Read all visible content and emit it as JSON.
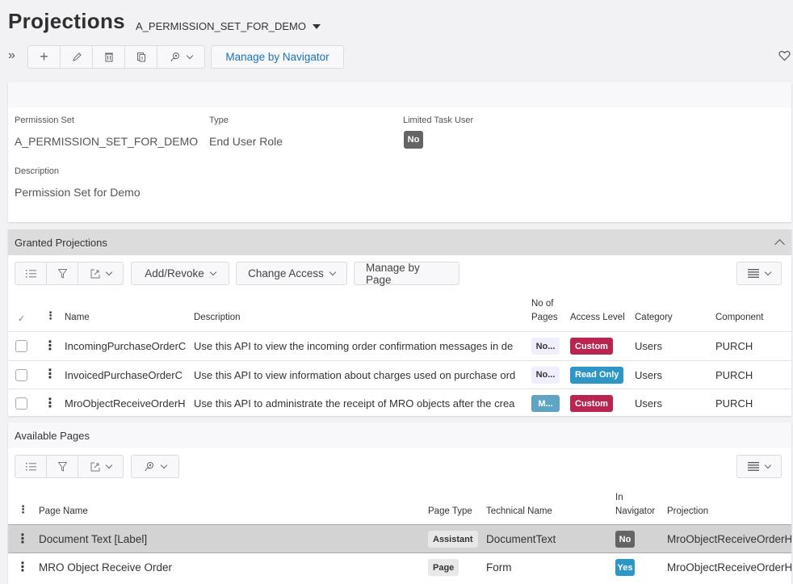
{
  "header": {
    "title": "Projections",
    "record_selector": "A_PERMISSION_SET_FOR_DEMO",
    "toolbar": {
      "icons": [
        "expand-icon",
        "add-icon",
        "edit-icon",
        "delete-icon",
        "duplicate-icon",
        "user-action-icon"
      ],
      "manage_by_navigator": "Manage by Navigator"
    },
    "favorite_icon": "heart-icon"
  },
  "details": {
    "permission_set_label": "Permission Set",
    "permission_set_value": "A_PERMISSION_SET_FOR_DEMO",
    "type_label": "Type",
    "type_value": "End User Role",
    "limited_task_user_label": "Limited Task User",
    "limited_task_user_value": "No",
    "description_label": "Description",
    "description_value": "Permission Set for Demo"
  },
  "granted_projections": {
    "title": "Granted Projections",
    "buttons": {
      "add_revoke": "Add/Revoke",
      "change_access": "Change Access",
      "manage_by_page": "Manage by Page"
    },
    "columns": {
      "name": "Name",
      "description": "Description",
      "no_of_pages_1": "No of",
      "no_of_pages_2": "Pages",
      "access_level": "Access Level",
      "category": "Category",
      "component": "Component"
    },
    "rows": [
      {
        "name": "IncomingPurchaseOrderC",
        "description": "Use this API to view the incoming order confirmation messages in de",
        "no_of_pages": "No...",
        "access_level": "Custom",
        "category": "Users",
        "component": "PURCH"
      },
      {
        "name": "InvoicedPurchaseOrderC",
        "description": "Use this API to view information about charges used on purchase ord",
        "no_of_pages": "No...",
        "access_level": "Read Only",
        "category": "Users",
        "component": "PURCH"
      },
      {
        "name": "MroObjectReceiveOrderH",
        "description": "Use this API to administrate the receipt of MRO objects after the crea",
        "no_of_pages": "M...",
        "access_level": "Custom",
        "category": "Users",
        "component": "PURCH"
      }
    ]
  },
  "available_pages": {
    "title": "Available Pages",
    "columns": {
      "page_name": "Page Name",
      "page_type": "Page Type",
      "technical_name": "Technical Name",
      "in_navigator_1": "In",
      "in_navigator_2": "Navigator",
      "projection": "Projection"
    },
    "rows": [
      {
        "page_name": "Document Text [Label]",
        "page_type": "Assistant",
        "technical_name": "DocumentText",
        "in_navigator": "No",
        "projection": "MroObjectReceiveOrderH"
      },
      {
        "page_name": "MRO Object Receive Order",
        "page_type": "Page",
        "technical_name": "Form",
        "in_navigator": "Yes",
        "projection": "MroObjectReceiveOrderH"
      }
    ]
  },
  "colors": {
    "link": "#1a73b8",
    "custom_badge": "#b8254e",
    "read_only_badge": "#2d96c4",
    "no_badge": "#646464",
    "section_header": "#dcdcdc"
  }
}
